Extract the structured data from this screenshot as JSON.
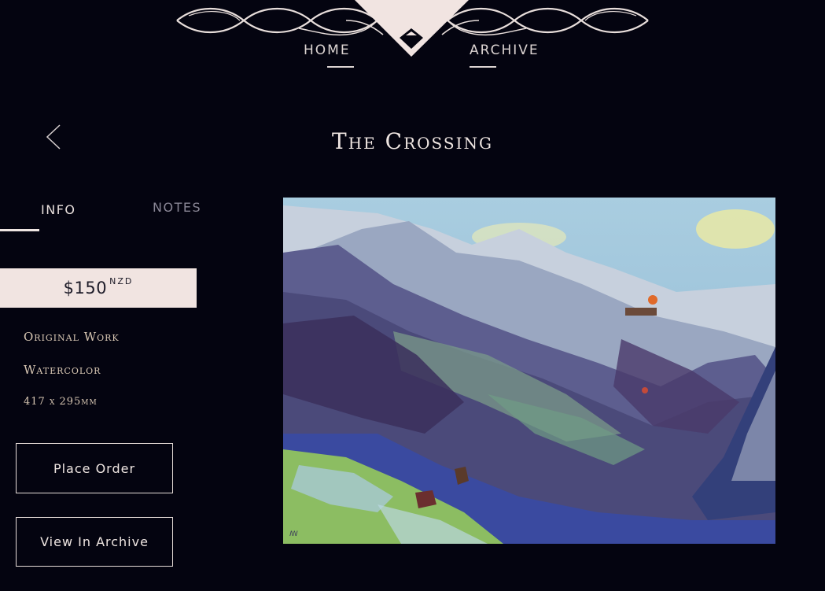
{
  "header": {
    "nav": [
      {
        "label": "HOME"
      },
      {
        "label": "ARCHIVE"
      }
    ]
  },
  "artwork": {
    "title": "The Crossing",
    "tabs": [
      {
        "label": "INFO",
        "active": true
      },
      {
        "label": "NOTES",
        "active": false
      }
    ],
    "price": {
      "amount": "$150",
      "currency": "NZD"
    },
    "details": [
      "Original Work",
      "Watercolor",
      "417 x 295mm"
    ],
    "buttons": {
      "order": "Place Order",
      "archive": "View In Archive"
    }
  },
  "icons": {
    "back": "chevron-left-icon",
    "logo": "mountain-diamond-icon"
  },
  "colors": {
    "background": "#040410",
    "accent": "#f1e4e1",
    "text": "#efe6e2",
    "detail_text": "#d9c8b4",
    "muted_tab": "#8a8796"
  }
}
